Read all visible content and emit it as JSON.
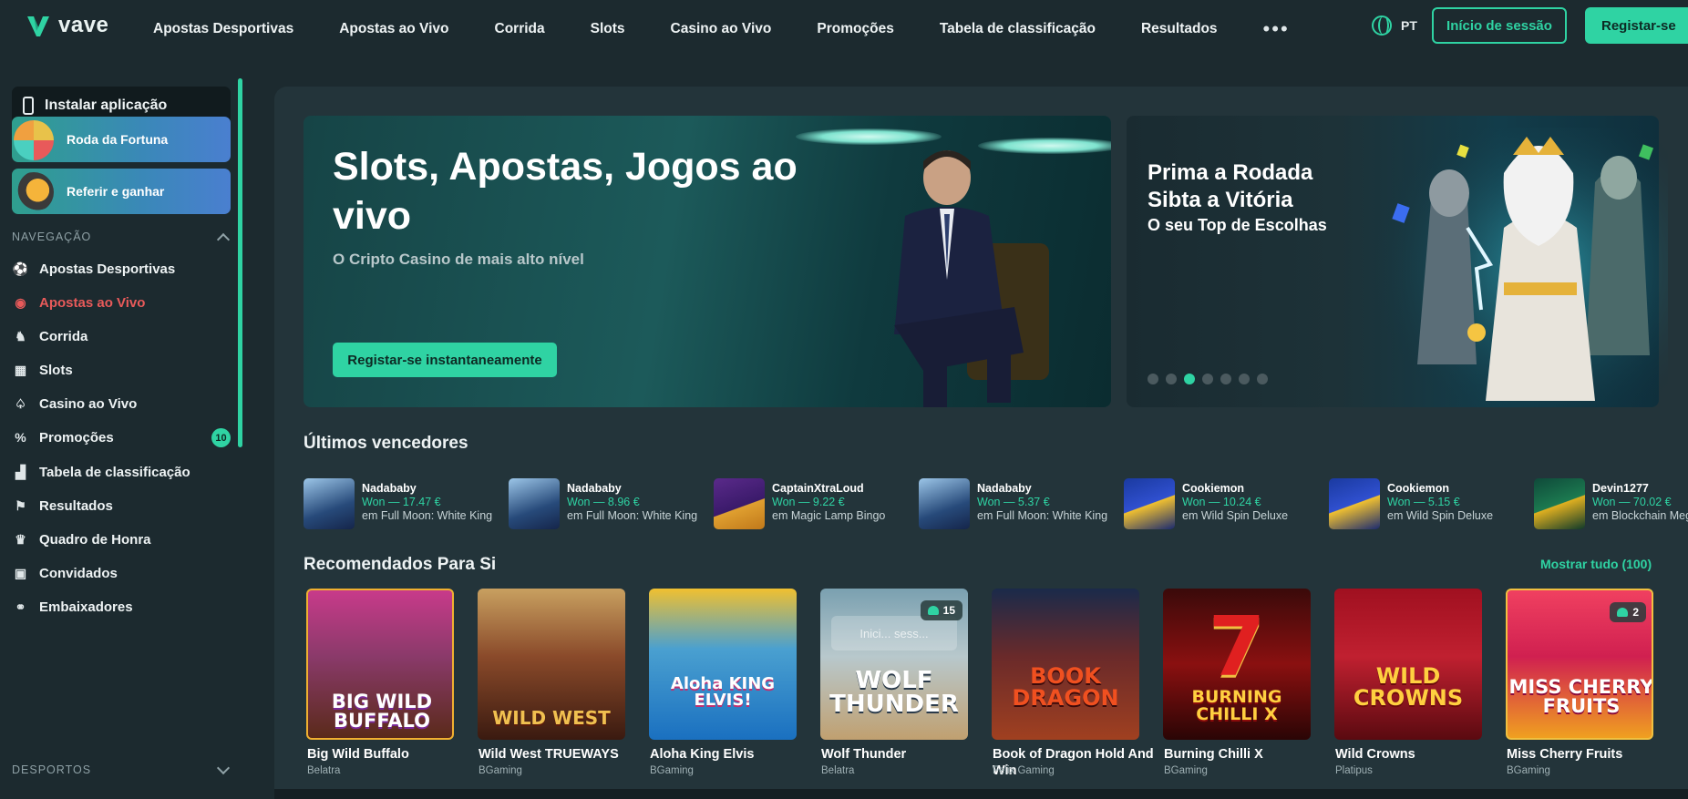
{
  "header": {
    "logo_text": "vave",
    "nav": [
      "Apostas Desportivas",
      "Apostas ao Vivo",
      "Corrida",
      "Slots",
      "Casino ao Vivo",
      "Promoções",
      "Tabela de classificação",
      "Resultados"
    ],
    "more": "•••",
    "lang": "PT",
    "login": "Início de sessão",
    "register": "Registar-se"
  },
  "sidebar": {
    "install": "Instalar aplicação",
    "promos": [
      "Roda da Fortuna",
      "Referir e ganhar"
    ],
    "nav_section": "NAVEGAÇÃO",
    "items": [
      {
        "label": "Apostas Desportivas",
        "icon": "soccer-ball-icon"
      },
      {
        "label": "Apostas ao Vivo",
        "icon": "live-signal-icon"
      },
      {
        "label": "Corrida",
        "icon": "horse-icon"
      },
      {
        "label": "Slots",
        "icon": "slot-machine-icon"
      },
      {
        "label": "Casino ao Vivo",
        "icon": "cards-icon"
      },
      {
        "label": "Promoções",
        "icon": "percent-icon"
      },
      {
        "label": "Tabela de classificação",
        "icon": "podium-icon"
      },
      {
        "label": "Resultados",
        "icon": "flag-icon"
      },
      {
        "label": "Quadro de Honra",
        "icon": "trophy-icon"
      },
      {
        "label": "Convidados",
        "icon": "wallet-icon"
      },
      {
        "label": "Embaixadores",
        "icon": "handshake-icon"
      }
    ],
    "promo_badge": "10",
    "sports_section": "DESPORTOS"
  },
  "hero": {
    "title": "Slots, Apostas, Jogos ao vivo",
    "subtitle": "O Cripto Casino de mais alto nível",
    "cta": "Registar-se instantaneamente"
  },
  "hero2": {
    "title_line1": "Prima a Rodada",
    "title_line2": "Sibta a Vitória",
    "subtitle": "O seu Top de Escolhas",
    "dots_total": 7,
    "dots_active_index": 2
  },
  "winners": {
    "title": "Últimos vencedores",
    "items": [
      {
        "name": "Nadababy",
        "won": "Won — 17.47 €",
        "game": "em Full Moon: White King"
      },
      {
        "name": "Nadababy",
        "won": "Won — 8.96 €",
        "game": "em Full Moon: White King"
      },
      {
        "name": "CaptainXtraLoud",
        "won": "Won — 9.22 €",
        "game": "em Magic Lamp Bingo"
      },
      {
        "name": "Nadababy",
        "won": "Won — 5.37 €",
        "game": "em Full Moon: White King"
      },
      {
        "name": "Cookiemon",
        "won": "Won — 10.24 €",
        "game": "em Wild Spin Deluxe"
      },
      {
        "name": "Cookiemon",
        "won": "Won — 5.15 €",
        "game": "em Wild Spin Deluxe"
      },
      {
        "name": "Devin1277",
        "won": "Won — 70.02 €",
        "game": "em Blockchain Megaways"
      }
    ]
  },
  "recommended": {
    "title": "Recomendados Para Si",
    "show_all": "Mostrar tudo (100)",
    "games": [
      {
        "name": "Big Wild Buffalo",
        "provider": "Belatra",
        "art": "BIG WILD BUFFALO"
      },
      {
        "name": "Wild West TRUEWAYS",
        "provider": "BGaming",
        "art": "WILD WEST"
      },
      {
        "name": "Aloha King Elvis",
        "provider": "BGaming",
        "art": "Aloha KING ELVIS!"
      },
      {
        "name": "Wolf Thunder",
        "provider": "Belatra",
        "art": "WOLF THUNDER",
        "players": "15",
        "overlay": "Inici... sess..."
      },
      {
        "name": "Book of Dragon Hold And Win",
        "provider": "Felix Gaming",
        "art": "BOOK DRAGON"
      },
      {
        "name": "Burning Chilli X",
        "provider": "BGaming",
        "art": "BURNING CHILLI X"
      },
      {
        "name": "Wild Crowns",
        "provider": "Platipus",
        "art": "WILD CROWNS"
      },
      {
        "name": "Miss Cherry Fruits",
        "provider": "BGaming",
        "art": "MISS CHERRY FRUITS",
        "players": "2"
      }
    ]
  }
}
